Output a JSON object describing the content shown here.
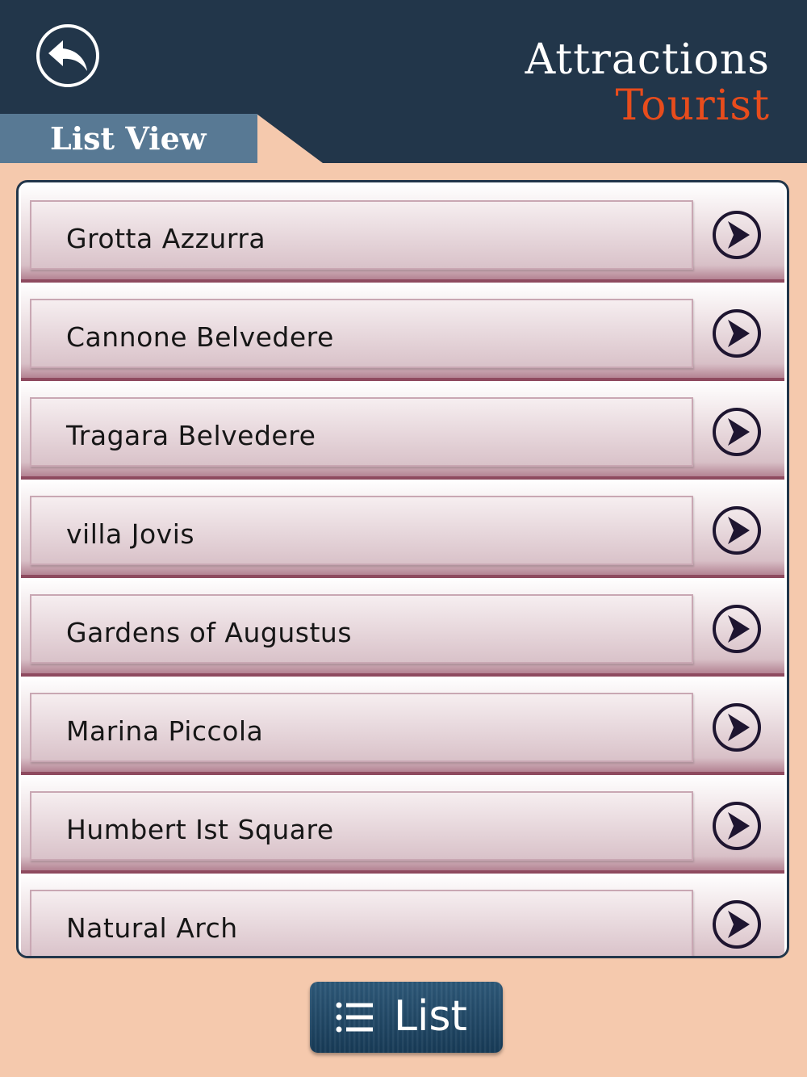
{
  "header": {
    "title_line1": "Attractions",
    "title_line2": "Tourist",
    "tab_label": "List View",
    "back_icon": "back-arrow-icon"
  },
  "colors": {
    "header_bg": "#22364a",
    "tab_bg": "#587994",
    "accent_title": "#e84c1c",
    "page_bg": "#f5c9ad"
  },
  "items": [
    {
      "label": "Grotta Azzurra"
    },
    {
      "label": "Cannone Belvedere"
    },
    {
      "label": "Tragara Belvedere"
    },
    {
      "label": "villa Jovis"
    },
    {
      "label": "Gardens of Augustus"
    },
    {
      "label": "Marina Piccola"
    },
    {
      "label": "Humbert Ist Square"
    },
    {
      "label": "Natural Arch"
    }
  ],
  "bottom_button": {
    "label": "List",
    "icon": "list-icon"
  }
}
